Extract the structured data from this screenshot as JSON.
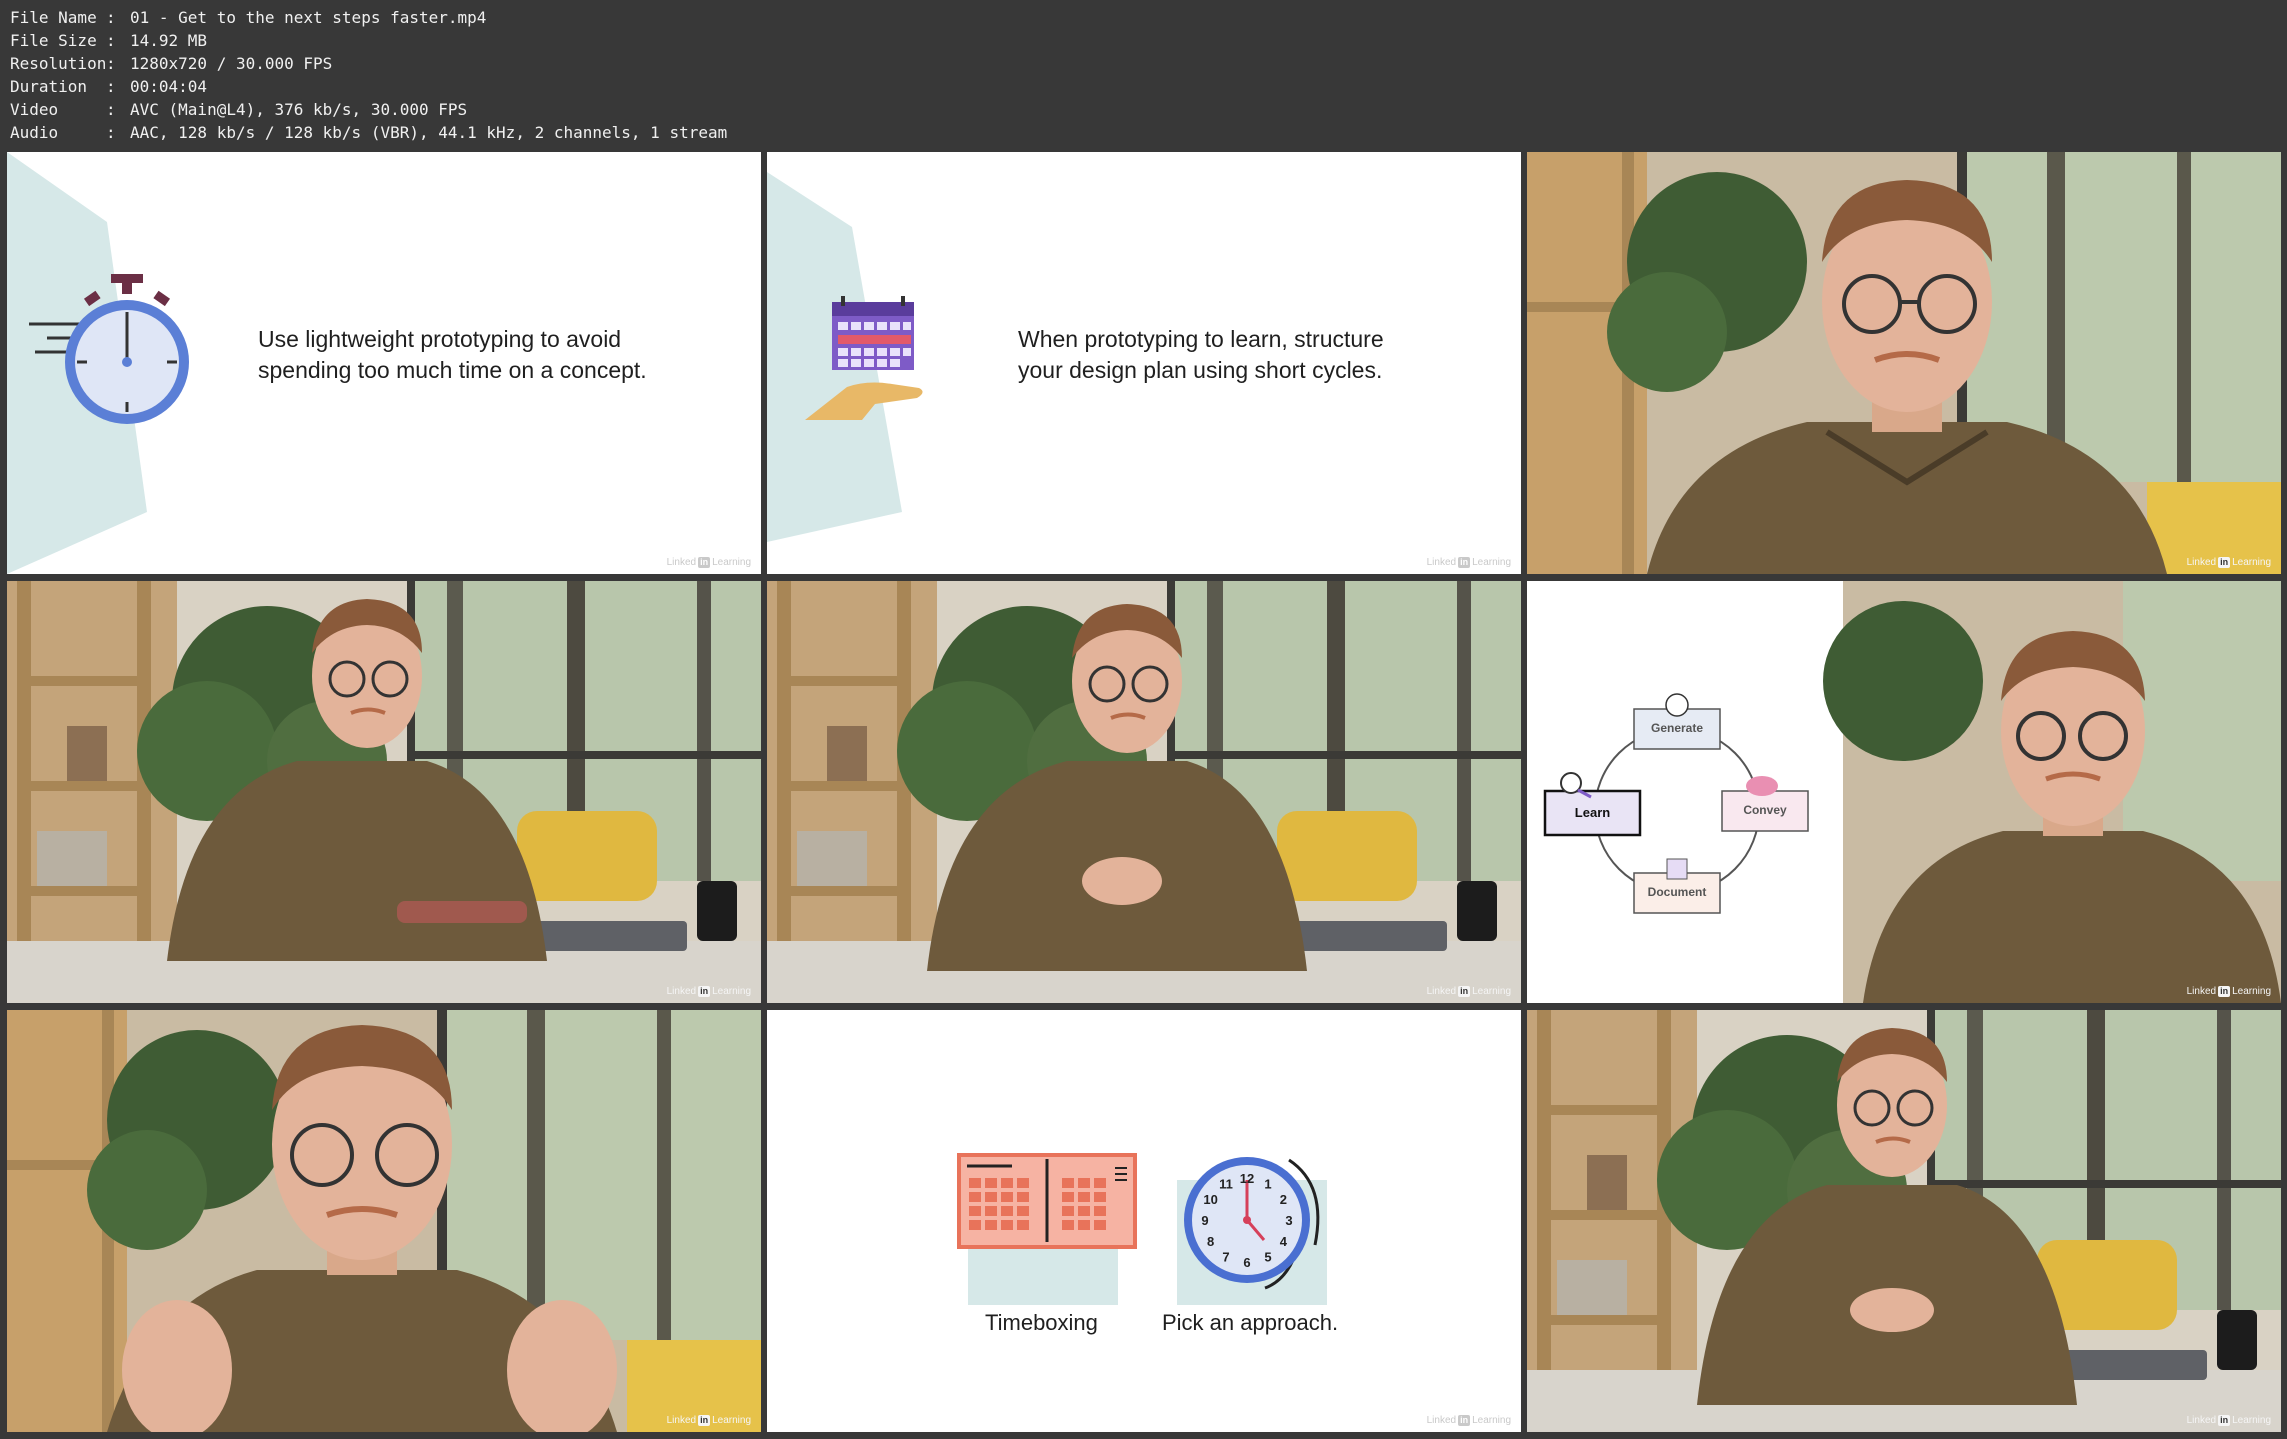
{
  "info": {
    "rows": [
      {
        "key": "File Name",
        "value": "01 - Get to the next steps faster.mp4"
      },
      {
        "key": "File Size",
        "value": "14.92 MB"
      },
      {
        "key": "Resolution",
        "value": "1280x720 / 30.000 FPS"
      },
      {
        "key": "Duration",
        "value": "00:04:04"
      },
      {
        "key": "Video",
        "value": "AVC (Main@L4), 376 kb/s, 30.000 FPS"
      },
      {
        "key": "Audio",
        "value": "AAC, 128 kb/s / 128 kb/s (VBR), 44.1 kHz, 2 channels, 1 stream"
      }
    ],
    "separator": ":"
  },
  "tiles": {
    "t1": {
      "lines": [
        "Use lightweight prototyping to avoid",
        "spending too much time on a concept."
      ]
    },
    "t2": {
      "lines": [
        "When prototyping to learn, structure",
        "your design plan using short cycles."
      ]
    },
    "t6": {
      "cycle": {
        "top": "Generate",
        "right": "Convey",
        "bottom": "Document",
        "left": "Learn"
      }
    },
    "t8": {
      "labels": [
        "Timeboxing",
        "Pick an approach."
      ],
      "clock_numbers": [
        "12",
        "1",
        "2",
        "3",
        "4",
        "5",
        "6",
        "7",
        "8",
        "9",
        "10",
        "11"
      ]
    }
  },
  "watermark": {
    "brand": "Linked",
    "badge": "in",
    "suffix": "Learning"
  },
  "colors": {
    "background": "#383838",
    "info_text": "#f0f0f0",
    "slide_bg": "#ffffff",
    "teal_panel": "#d6e8e8",
    "stopwatch_blue": "#5b7fd6",
    "stopwatch_cap": "#6b2f45",
    "calendar_purple": "#7e5bc7",
    "hand_orange": "#e8b867",
    "timebox_red": "#e8735a",
    "clock_blue": "#4a6fd1",
    "sweater": "#6e5a3c"
  }
}
